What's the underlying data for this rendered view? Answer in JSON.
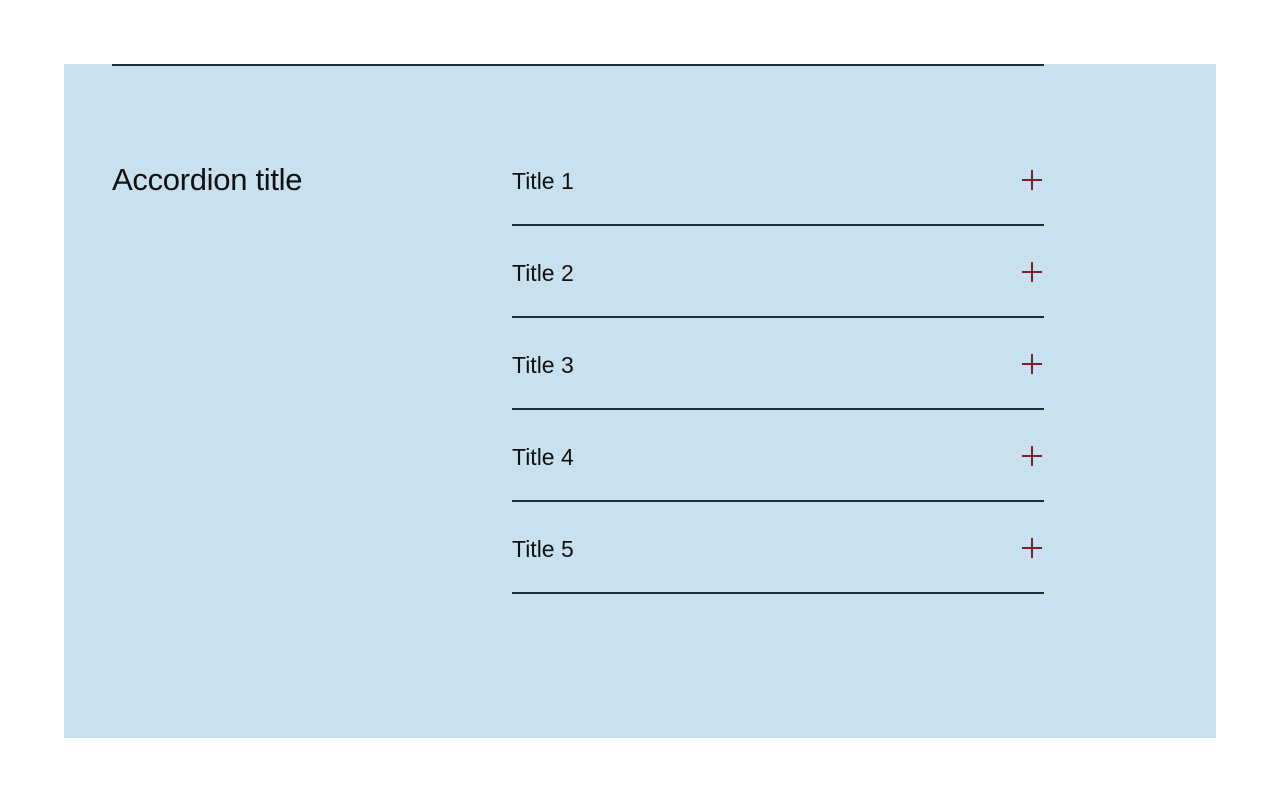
{
  "section": {
    "title": "Accordion title"
  },
  "accordion": {
    "items": [
      {
        "label": "Title 1",
        "icon": "plus-icon"
      },
      {
        "label": "Title 2",
        "icon": "plus-icon"
      },
      {
        "label": "Title 3",
        "icon": "plus-icon"
      },
      {
        "label": "Title 4",
        "icon": "plus-icon"
      },
      {
        "label": "Title 5",
        "icon": "plus-icon"
      }
    ]
  },
  "colors": {
    "panel_background": "#c9e0ee",
    "divider": "#1c2d3a",
    "icon_accent": "#7a1f2b",
    "text": "#111111"
  }
}
